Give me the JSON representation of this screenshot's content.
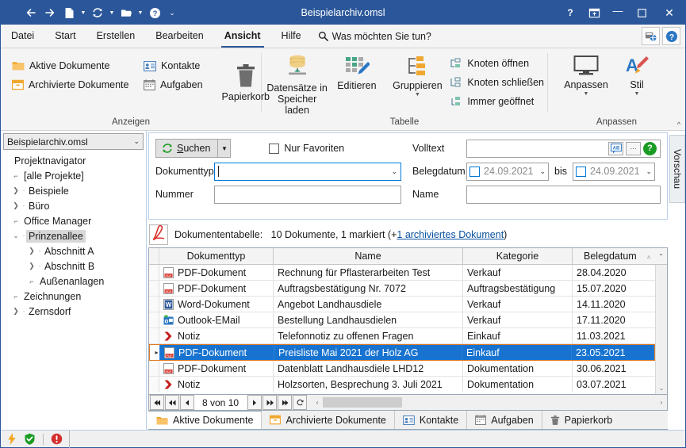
{
  "window": {
    "title": "Beispielarchiv.omsl",
    "quick_access": [
      {
        "name": "back-icon",
        "glyph": "←"
      },
      {
        "name": "forward-icon",
        "glyph": "→"
      },
      {
        "name": "new-document-icon",
        "glyph": "page"
      },
      {
        "name": "refresh-icon",
        "glyph": "↻"
      },
      {
        "name": "open-folder-icon",
        "glyph": "folder"
      },
      {
        "name": "help-circle-icon",
        "glyph": "?"
      },
      {
        "name": "overflow-icon",
        "glyph": "⌄"
      }
    ],
    "controls": {
      "help": "?",
      "restore_up": "⍐",
      "minimize": "—",
      "maximize": "☐",
      "close": "✕"
    }
  },
  "ribbon": {
    "tabs": [
      {
        "label": "Datei",
        "active": false
      },
      {
        "label": "Start",
        "active": false
      },
      {
        "label": "Erstellen",
        "active": false
      },
      {
        "label": "Bearbeiten",
        "active": false
      },
      {
        "label": "Ansicht",
        "active": true
      },
      {
        "label": "Hilfe",
        "active": false
      }
    ],
    "tellme": "Was möchten Sie tun?",
    "groups": [
      {
        "label": "Anzeigen",
        "small_items": [
          {
            "label": "Aktive Dokumente",
            "icon": "folder-icon"
          },
          {
            "label": "Kontakte",
            "icon": "contact-card-icon"
          },
          {
            "label": "Archivierte Dokumente",
            "icon": "archive-box-icon"
          },
          {
            "label": "Aufgaben",
            "icon": "calendar-icon"
          }
        ],
        "big_items": [
          {
            "label": "Papierkorb",
            "icon": "trash-icon"
          }
        ]
      },
      {
        "label": "Tabelle",
        "big_items": [
          {
            "label": "Datensätze in\nSpeicher laden",
            "icon": "database-icon"
          },
          {
            "label": "Editieren",
            "icon": "edit-grid-icon"
          },
          {
            "label": "Gruppieren",
            "icon": "group-tree-icon",
            "caret": true
          }
        ],
        "small_items": [
          {
            "label": "Knoten öffnen",
            "icon": "node-open-icon"
          },
          {
            "label": "Knoten schließen",
            "icon": "node-close-icon"
          },
          {
            "label": "Immer geöffnet",
            "icon": "node-always-open-icon"
          }
        ]
      },
      {
        "label": "Anpassen",
        "big_items": [
          {
            "label": "Anpassen",
            "icon": "monitor-icon",
            "caret": true
          },
          {
            "label": "Stil",
            "icon": "style-brush-icon",
            "caret": true
          }
        ]
      }
    ],
    "collapse_glyph": "^"
  },
  "sidebar": {
    "archive_select": "Beispielarchiv.omsl",
    "heading": "Projektnavigator",
    "items": [
      {
        "label": "[alle Projekte]",
        "indent": 0,
        "twisty": "none",
        "selected": false
      },
      {
        "label": "Beispiele",
        "indent": 0,
        "twisty": "collapsed",
        "selected": false
      },
      {
        "label": "Büro",
        "indent": 0,
        "twisty": "collapsed",
        "selected": false
      },
      {
        "label": "Office Manager",
        "indent": 0,
        "twisty": "none",
        "selected": false
      },
      {
        "label": "Prinzenallee",
        "indent": 0,
        "twisty": "expanded",
        "selected": true
      },
      {
        "label": "Abschnitt A",
        "indent": 1,
        "twisty": "collapsed",
        "selected": false
      },
      {
        "label": "Abschnitt B",
        "indent": 1,
        "twisty": "collapsed",
        "selected": false
      },
      {
        "label": "Außenanlagen",
        "indent": 1,
        "twisty": "none",
        "selected": false
      },
      {
        "label": "Zeichnungen",
        "indent": 0,
        "twisty": "none",
        "selected": false
      },
      {
        "label": "Zernsdorf",
        "indent": 0,
        "twisty": "collapsed",
        "selected": false
      }
    ]
  },
  "search": {
    "button_label": "Suchen",
    "button_accesskey_prefix": "S",
    "button_accesskey_rest": "uchen",
    "dropdown_caret": "▼",
    "only_favorites_label": "Nur Favoriten",
    "only_favorites_checked": false,
    "fields": {
      "dokumenttyp_label": "Dokumenttyp",
      "dokumenttyp_value": "",
      "nummer_label": "Nummer",
      "nummer_value": "",
      "volltext_label": "Volltext",
      "volltext_value": "",
      "belegdatum_label": "Belegdatum",
      "belegdatum_from": "24.09.2021",
      "belegdatum_to": "24.09.2021",
      "bis_label": "bis",
      "name_label": "Name",
      "name_value": ""
    },
    "volltext_buttons": {
      "ab": "AB",
      "more": "···",
      "help": "?"
    }
  },
  "preview_tab": "Vorschau",
  "table": {
    "summary_prefix": "Dokumententabelle:",
    "summary_counts": "10 Dokumente, 1 markiert (+",
    "summary_link": "1 archiviertes Dokument",
    "summary_suffix": ")",
    "columns": [
      {
        "label": "Dokumenttyp"
      },
      {
        "label": "Name"
      },
      {
        "label": "Kategorie"
      },
      {
        "label": "Belegdatum",
        "sort": "▵"
      }
    ],
    "rows": [
      {
        "icon": "pdf-icon",
        "typ": "PDF-Dokument",
        "name": "Rechnung für Pflasterarbeiten Test",
        "kategorie": "Verkauf",
        "datum": "28.04.2020",
        "selected": false,
        "indicator": ""
      },
      {
        "icon": "pdf-icon",
        "typ": "PDF-Dokument",
        "name": "Auftragsbestätigung Nr. 7072",
        "kategorie": "Auftragsbestätigung",
        "datum": "15.07.2020",
        "selected": false,
        "indicator": ""
      },
      {
        "icon": "word-icon",
        "typ": "Word-Dokument",
        "name": "Angebot Landhausdiele",
        "kategorie": "Verkauf",
        "datum": "14.11.2020",
        "selected": false,
        "indicator": ""
      },
      {
        "icon": "outlook-icon",
        "typ": "Outlook-EMail",
        "name": "Bestellung Landhausdielen",
        "kategorie": "Verkauf",
        "datum": "17.11.2020",
        "selected": false,
        "indicator": ""
      },
      {
        "icon": "note-icon",
        "typ": "Notiz",
        "name": "Telefonnotiz zu offenen Fragen",
        "kategorie": "Einkauf",
        "datum": "11.03.2021",
        "selected": false,
        "indicator": ""
      },
      {
        "icon": "pdf-icon",
        "typ": "PDF-Dokument",
        "name": "Preisliste Mai 2021 der Holz AG",
        "kategorie": "Einkauf",
        "datum": "23.05.2021",
        "selected": true,
        "indicator": "▸"
      },
      {
        "icon": "pdf-icon",
        "typ": "PDF-Dokument",
        "name": "Datenblatt Landhausdiele LHD12",
        "kategorie": "Dokumentation",
        "datum": "30.06.2021",
        "selected": false,
        "indicator": ""
      },
      {
        "icon": "note-icon",
        "typ": "Notiz",
        "name": "Holzsorten, Besprechung 3. Juli 2021",
        "kategorie": "Dokumentation",
        "datum": "03.07.2021",
        "selected": false,
        "indicator": ""
      }
    ]
  },
  "pager": {
    "first": "⏮",
    "prev_page": "⏪",
    "prev": "◀",
    "position": "8 von 10",
    "next": "▶",
    "next_page": "⏩",
    "last": "⏭",
    "refresh": "↻",
    "h_left": "‹",
    "h_right": "›"
  },
  "bottom_tabs": [
    {
      "label": "Aktive Dokumente",
      "icon": "folder-icon",
      "active": true
    },
    {
      "label": "Archivierte Dokumente",
      "icon": "archive-box-icon",
      "active": false
    },
    {
      "label": "Kontakte",
      "icon": "contact-card-icon",
      "active": false
    },
    {
      "label": "Aufgaben",
      "icon": "calendar-icon",
      "active": false
    },
    {
      "label": "Papierkorb",
      "icon": "trash-icon",
      "active": false
    }
  ],
  "statusbar": {
    "icons": [
      {
        "name": "lightning-icon",
        "color": "#f5a623"
      },
      {
        "name": "shield-check-icon",
        "color": "#1a9b23"
      },
      {
        "name": "error-circle-icon",
        "color": "#d32f2f"
      }
    ]
  },
  "colors": {
    "title_blue": "#2b579a",
    "selection_blue": "#1773cf",
    "selection_border": "#e07b24",
    "link_blue": "#0a50a0",
    "accent_orange": "#f0a830"
  }
}
